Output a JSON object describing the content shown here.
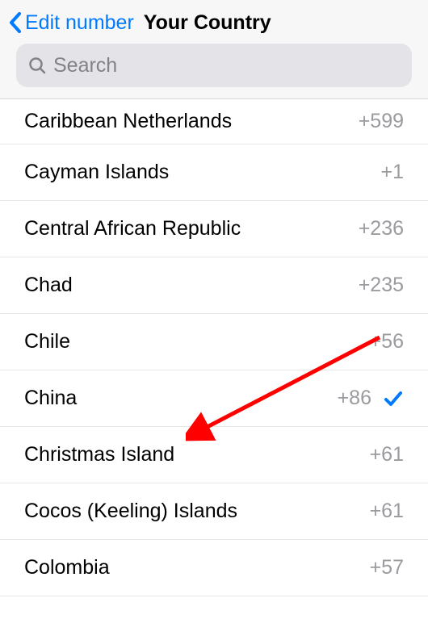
{
  "header": {
    "back_label": "Edit number",
    "title": "Your Country"
  },
  "search": {
    "placeholder": "Search"
  },
  "countries": [
    {
      "name": "Caribbean Netherlands",
      "dial": "+599",
      "selected": false
    },
    {
      "name": "Cayman Islands",
      "dial": "+1",
      "selected": false
    },
    {
      "name": "Central African Republic",
      "dial": "+236",
      "selected": false
    },
    {
      "name": "Chad",
      "dial": "+235",
      "selected": false
    },
    {
      "name": "Chile",
      "dial": "+56",
      "selected": false
    },
    {
      "name": "China",
      "dial": "+86",
      "selected": true
    },
    {
      "name": "Christmas Island",
      "dial": "+61",
      "selected": false
    },
    {
      "name": "Cocos (Keeling) Islands",
      "dial": "+61",
      "selected": false
    },
    {
      "name": "Colombia",
      "dial": "+57",
      "selected": false
    }
  ],
  "colors": {
    "accent": "#007aff",
    "muted": "#9a9a9f",
    "annotation": "#ff0000"
  }
}
